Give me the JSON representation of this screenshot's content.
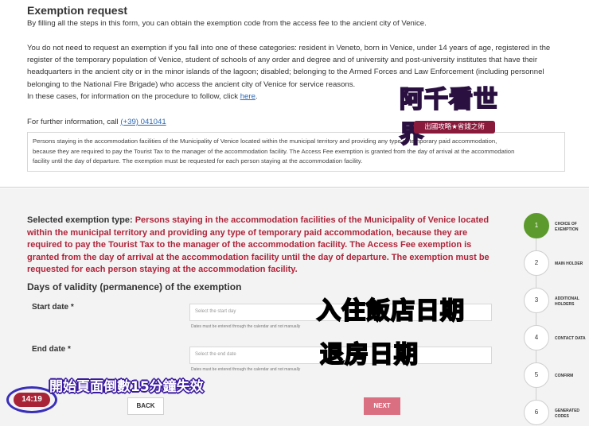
{
  "top": {
    "title": "Exemption request",
    "intro": "By filling all the steps in this form, you can obtain the exemption code from the access fee to the ancient city of Venice.",
    "categories_1": "You do not need to request an exemption if you fall into one of these categories: resident in Veneto, born in Venice, under 14 years of age, registered in the",
    "categories_2": "register of the temporary population of Venice, student of schools of any order and degree and of university and post-university institutes that have their",
    "categories_3": "headquarters in the ancient city or in the minor islands of the lagoon; disabled; belonging to the Armed Forces and Law Enforcement (including personnel",
    "categories_4": "belonging to the National Fire Brigade) who access the ancient city of Venice for service reasons.",
    "cases_text": "In these cases, for information on the procedure to follow, click ",
    "cases_link": "here",
    "cases_end": ".",
    "info_text": "For further information, call ",
    "info_phone": "(+39) 041041",
    "selected_box_1": "Persons staying in the accommodation facilities of the Municipality of Venice located within the municipal territory and providing any type of temporary paid accommodation,",
    "selected_box_2": "because they are required to pay the Tourist Tax to the manager of the accommodation facility. The Access Fee exemption is granted from the day of arrival at the accommodation",
    "selected_box_3": "facility until the day of departure. The exemption must be requested for each person staying at the accommodation facility."
  },
  "logo": {
    "main": "阿千看世界",
    "banner": "出國攻略★省錢之術"
  },
  "form": {
    "selected_label": "Selected exemption type: ",
    "selected_value": "Persons staying in the accommodation facilities of the Municipality of Venice located within the municipal territory and providing any type of temporary paid accommodation, because they are required to pay the Tourist Tax to the manager of the accommodation facility. The Access Fee exemption is granted from the day of arrival at the accommodation facility until the day of departure. The exemption must be requested for each person staying at the accommodation facility.",
    "validity_title": "Days of validity (permanence) of the exemption",
    "start_label": "Start date *",
    "start_placeholder": "Select the start day",
    "start_hint": "Dates must be entered through the calendar and not manually",
    "end_label": "End date *",
    "end_placeholder": "Select the end date",
    "end_hint": "Dates must be entered through the calendar and not manually",
    "back_label": "BACK",
    "next_label": "NEXT"
  },
  "timer": {
    "value": "14:19"
  },
  "overlays": {
    "checkin": "入住飯店日期",
    "checkout": "退房日期",
    "countdown": "開始頁面倒數15分鐘失效"
  },
  "stepper": {
    "steps": [
      {
        "number": "1",
        "label": "CHOICE OF EXEMPTION"
      },
      {
        "number": "2",
        "label": "MAIN HOLDER"
      },
      {
        "number": "3",
        "label": "ADDITIONAL HOLDERS"
      },
      {
        "number": "4",
        "label": "CONTACT DATA"
      },
      {
        "number": "5",
        "label": "CONFIRM"
      },
      {
        "number": "6",
        "label": "GENERATED CODES"
      }
    ]
  },
  "colors": {
    "accent_red": "#b0243a",
    "step_active": "#5d9a2d",
    "link": "#2a67b5",
    "next_button": "#d96f80"
  }
}
